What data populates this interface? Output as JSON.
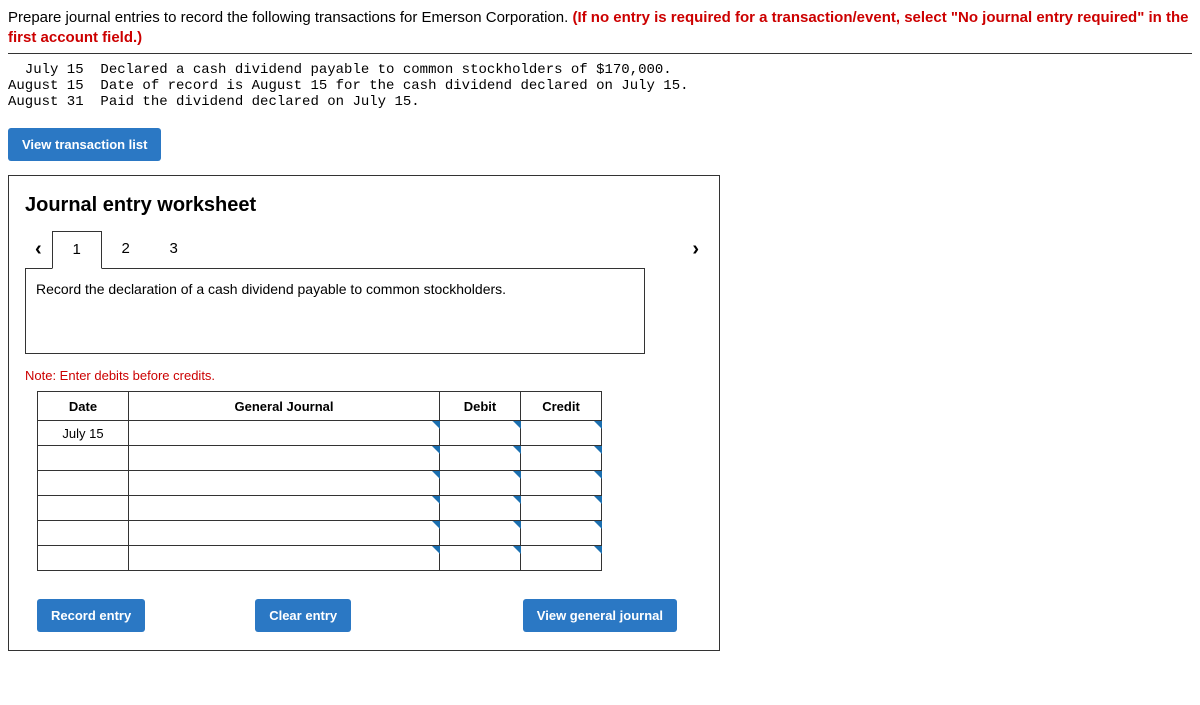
{
  "instruction": {
    "black": "Prepare journal entries to record the following transactions for Emerson Corporation. ",
    "red": "(If no entry is required for a transaction/event, select \"No journal entry required\" in the first account field.)"
  },
  "transactions": "  July 15  Declared a cash dividend payable to common stockholders of $170,000.\nAugust 15  Date of record is August 15 for the cash dividend declared on July 15.\nAugust 31  Paid the dividend declared on July 15.",
  "view_list_btn": "View transaction list",
  "worksheet": {
    "title": "Journal entry worksheet",
    "tabs": [
      "1",
      "2",
      "3"
    ],
    "description": "Record the declaration of a cash dividend payable to common stockholders.",
    "note": "Note: Enter debits before credits.",
    "headers": {
      "date": "Date",
      "gj": "General Journal",
      "debit": "Debit",
      "credit": "Credit"
    },
    "rows": [
      {
        "date": "July 15",
        "gj": "",
        "debit": "",
        "credit": ""
      },
      {
        "date": "",
        "gj": "",
        "debit": "",
        "credit": ""
      },
      {
        "date": "",
        "gj": "",
        "debit": "",
        "credit": ""
      },
      {
        "date": "",
        "gj": "",
        "debit": "",
        "credit": ""
      },
      {
        "date": "",
        "gj": "",
        "debit": "",
        "credit": ""
      },
      {
        "date": "",
        "gj": "",
        "debit": "",
        "credit": ""
      }
    ],
    "record_btn": "Record entry",
    "clear_btn": "Clear entry",
    "view_journal_btn": "View general journal"
  }
}
